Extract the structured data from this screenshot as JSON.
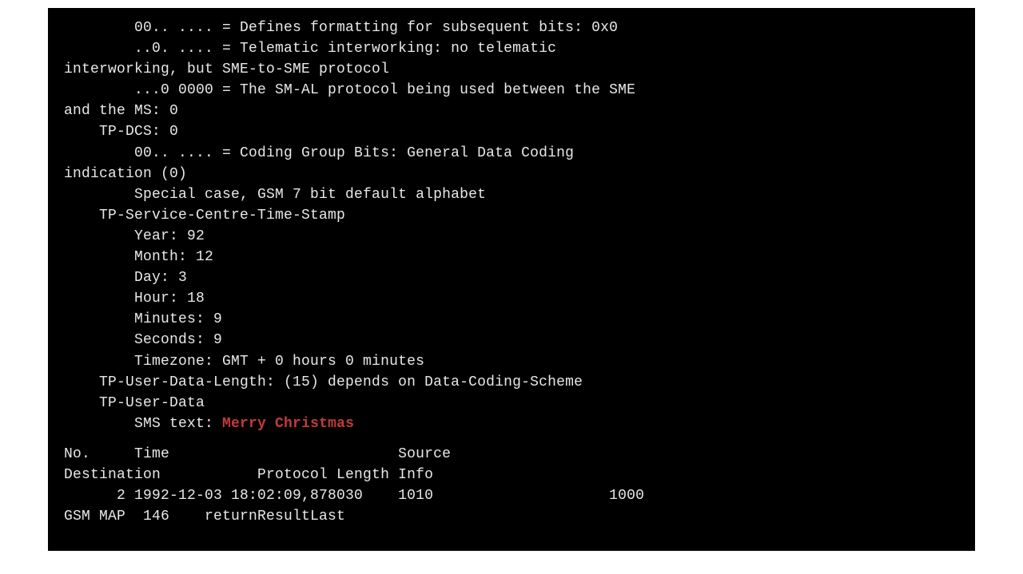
{
  "tp_pid": {
    "bits_format": "        00.. .... = Defines formatting for subsequent bits: 0x0",
    "telematic": "        ..0. .... = Telematic interworking: no telematic",
    "telematic_cont": "interworking, but SME-to-SME protocol",
    "sm_al": "        ...0 0000 = The SM-AL protocol being used between the SME",
    "sm_al_cont": "and the MS: 0"
  },
  "tp_dcs": {
    "header": "    TP-DCS: 0",
    "coding_group": "        00.. .... = Coding Group Bits: General Data Coding",
    "coding_group_cont": "indication (0)",
    "special_case": "        Special case, GSM 7 bit default alphabet"
  },
  "timestamp": {
    "header": "    TP-Service-Centre-Time-Stamp",
    "year": "        Year: 92",
    "month": "        Month: 12",
    "day": "        Day: 3",
    "hour": "        Hour: 18",
    "minutes": "        Minutes: 9",
    "seconds": "        Seconds: 9",
    "timezone": "        Timezone: GMT + 0 hours 0 minutes"
  },
  "user_data": {
    "length": "    TP-User-Data-Length: (15) depends on Data-Coding-Scheme",
    "header": "    TP-User-Data",
    "sms_label": "        SMS text: ",
    "sms_text": "Merry Christmas"
  },
  "packet_list": {
    "header1": "No.     Time                          Source",
    "header2": "Destination           Protocol Length Info",
    "row1": "      2 1992-12-03 18:02:09,878030    1010                    1000",
    "row2": "GSM MAP  146    returnResultLast"
  }
}
